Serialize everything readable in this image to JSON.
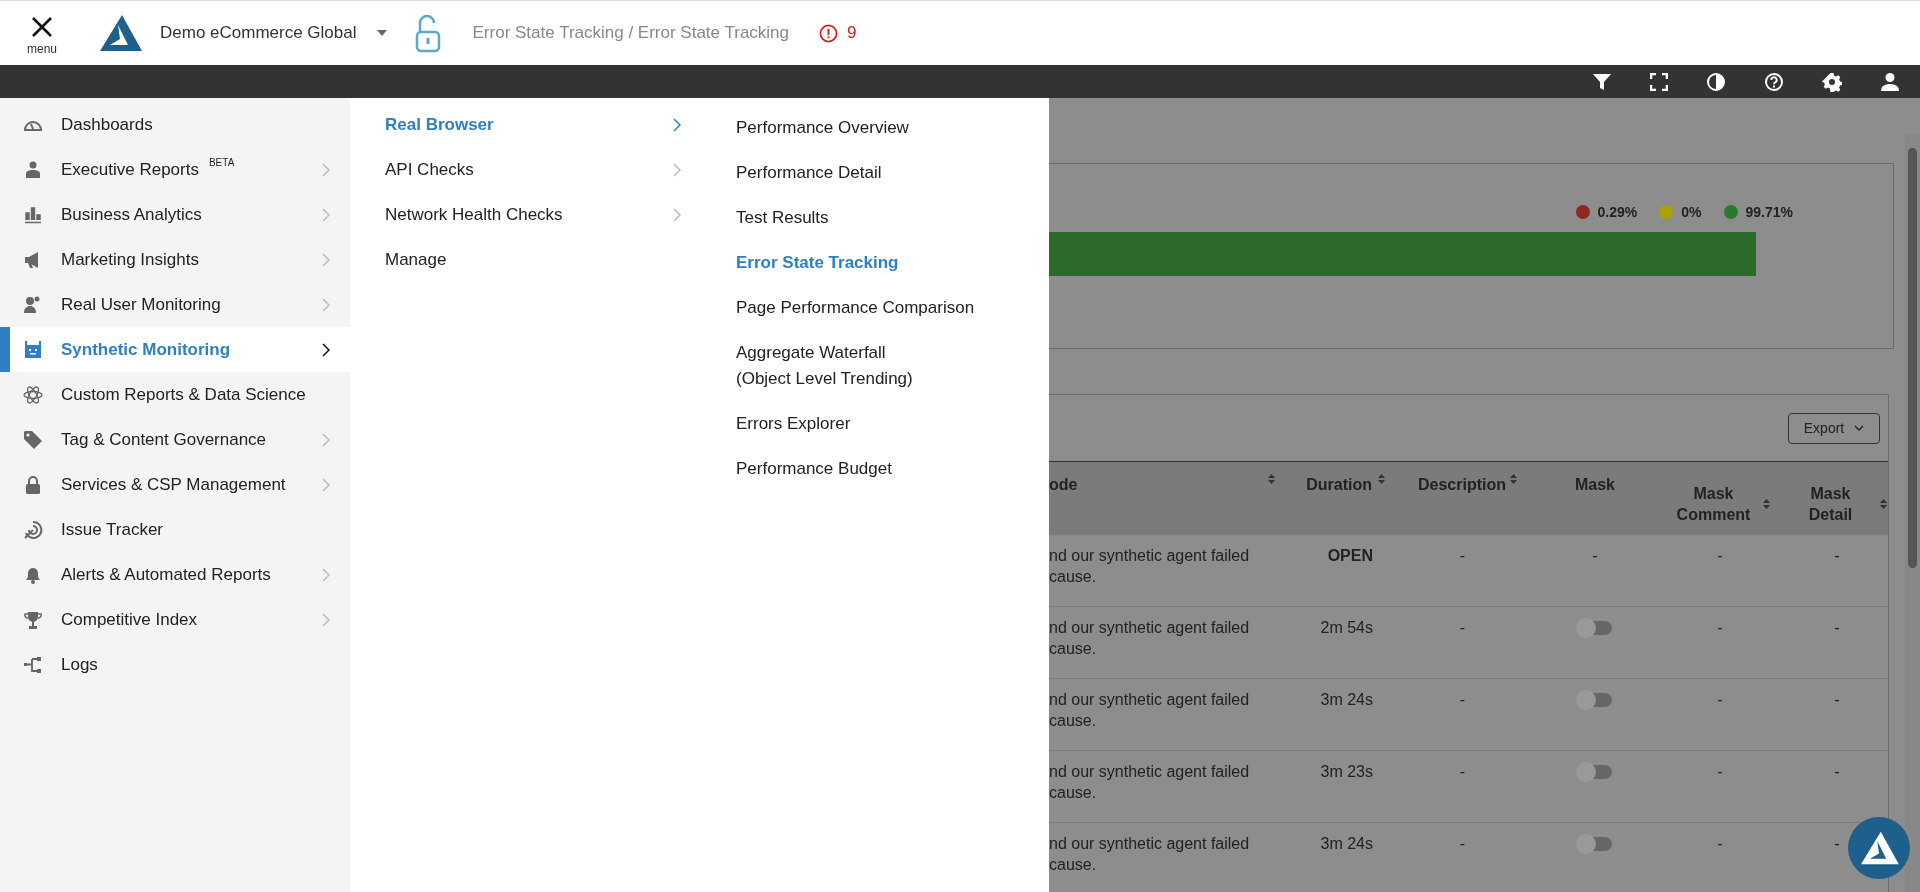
{
  "header": {
    "menu_label": "menu",
    "account": "Demo eCommerce Global",
    "breadcrumb": "Error State Tracking / Error State Tracking",
    "alert_count": "9"
  },
  "nav": [
    {
      "label": "Dashboards",
      "expandable": false,
      "selected": false
    },
    {
      "label": "Executive Reports",
      "badge": "BETA",
      "expandable": true,
      "selected": false
    },
    {
      "label": "Business Analytics",
      "expandable": true,
      "selected": false
    },
    {
      "label": "Marketing Insights",
      "expandable": true,
      "selected": false
    },
    {
      "label": "Real User Monitoring",
      "expandable": true,
      "selected": false
    },
    {
      "label": "Synthetic Monitoring",
      "expandable": true,
      "selected": true
    },
    {
      "label": "Custom Reports & Data Science",
      "expandable": false,
      "selected": false
    },
    {
      "label": "Tag & Content Governance",
      "expandable": true,
      "selected": false
    },
    {
      "label": "Services & CSP Management",
      "expandable": true,
      "selected": false
    },
    {
      "label": "Issue Tracker",
      "expandable": false,
      "selected": false
    },
    {
      "label": "Alerts & Automated Reports",
      "expandable": true,
      "selected": false
    },
    {
      "label": "Competitive Index",
      "expandable": true,
      "selected": false
    },
    {
      "label": "Logs",
      "expandable": false,
      "selected": false
    }
  ],
  "submenu": [
    {
      "label": "Real Browser",
      "expandable": true,
      "selected": true
    },
    {
      "label": "API Checks",
      "expandable": true,
      "selected": false
    },
    {
      "label": "Network Health Checks",
      "expandable": true,
      "selected": false
    },
    {
      "label": "Manage",
      "expandable": false,
      "selected": false
    }
  ],
  "pages": [
    {
      "label": "Performance Overview",
      "selected": false
    },
    {
      "label": "Performance Detail",
      "selected": false
    },
    {
      "label": "Test Results",
      "selected": false
    },
    {
      "label": "Error State Tracking",
      "selected": true
    },
    {
      "label": "Page Performance Comparison",
      "selected": false
    },
    {
      "label": "Aggregate Waterfall\n(Object Level Trending)",
      "selected": false
    },
    {
      "label": "Errors Explorer",
      "selected": false
    },
    {
      "label": "Performance Budget",
      "selected": false
    }
  ],
  "summary": {
    "legend": [
      {
        "text": "0.29%",
        "color": "#8f2a22"
      },
      {
        "text": "0%",
        "color": "#a9a300"
      },
      {
        "text": "99.71%",
        "color": "#2b7a2b"
      }
    ]
  },
  "table": {
    "export_label": "Export",
    "columns": [
      {
        "label": "ode",
        "sortable": true
      },
      {
        "label": "Duration",
        "sortable": true
      },
      {
        "label": "Description",
        "sortable": true
      },
      {
        "label": "Mask",
        "sortable": false
      },
      {
        "label": "Mask Comment",
        "sortable": true
      },
      {
        "label": "Mask Detail",
        "sortable": true
      }
    ],
    "rows": [
      {
        "code": "nd our synthetic agent failed\ncause.",
        "duration": "OPEN",
        "open": true,
        "description": "-",
        "mask": {
          "kind": "text",
          "text": "-"
        },
        "mask_comment": "-",
        "mask_detail": "-"
      },
      {
        "code": "nd our synthetic agent failed\ncause.",
        "duration": "2m 54s",
        "open": false,
        "description": "-",
        "mask": {
          "kind": "toggle",
          "on": false
        },
        "mask_comment": "-",
        "mask_detail": "-"
      },
      {
        "code": "nd our synthetic agent failed\ncause.",
        "duration": "3m 24s",
        "open": false,
        "description": "-",
        "mask": {
          "kind": "toggle",
          "on": false
        },
        "mask_comment": "-",
        "mask_detail": "-"
      },
      {
        "code": "nd our synthetic agent failed\ncause.",
        "duration": "3m 23s",
        "open": false,
        "description": "-",
        "mask": {
          "kind": "toggle",
          "on": false
        },
        "mask_comment": "-",
        "mask_detail": "-"
      },
      {
        "code": "nd our synthetic agent failed\ncause.",
        "duration": "3m 24s",
        "open": false,
        "description": "-",
        "mask": {
          "kind": "toggle",
          "on": false
        },
        "mask_comment": "-",
        "mask_detail": "-"
      }
    ]
  }
}
